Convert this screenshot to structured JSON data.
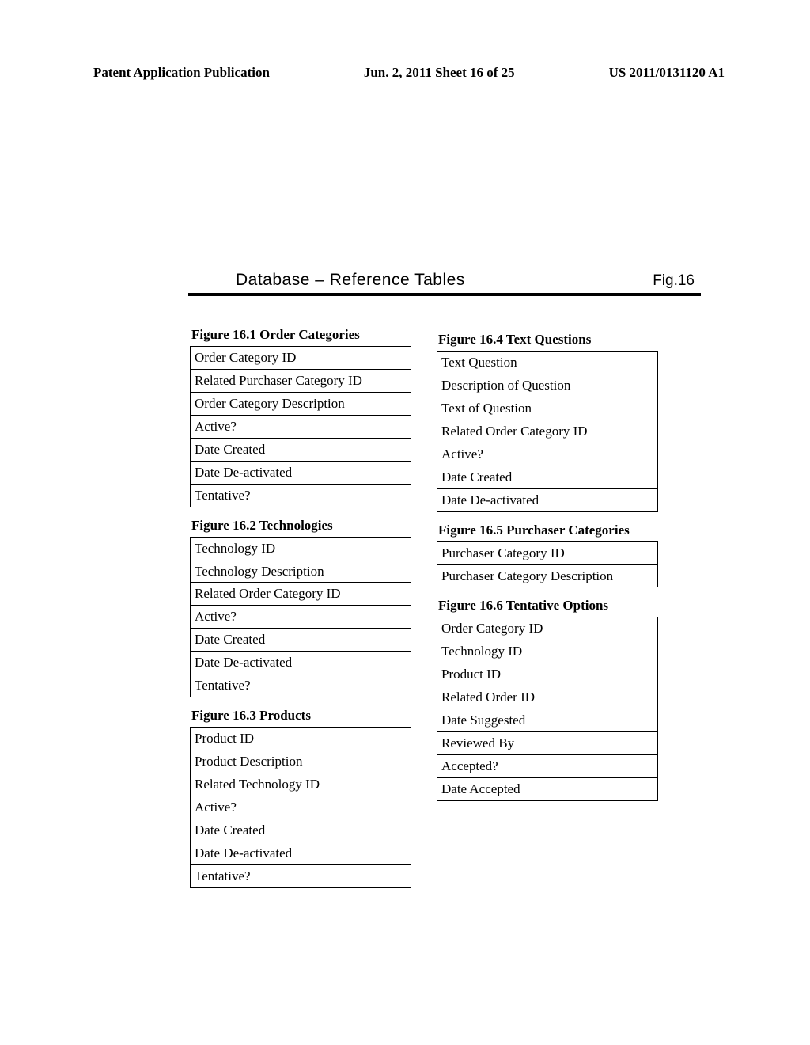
{
  "header": {
    "left": "Patent Application Publication",
    "mid": "Jun. 2, 2011  Sheet 16 of 25",
    "right": "US 2011/0131120 A1"
  },
  "main": {
    "title": "Database – Reference Tables",
    "figLabel": "Fig.16"
  },
  "tables": {
    "t1": {
      "caption": "Figure 16.1 Order Categories",
      "rows": [
        "Order Category ID",
        "Related Purchaser Category ID",
        "Order Category Description",
        "Active?",
        "Date Created",
        "Date De-activated",
        "Tentative?"
      ]
    },
    "t2": {
      "caption": "Figure 16.2 Technologies",
      "rows": [
        "Technology ID",
        "Technology Description",
        "Related Order Category ID",
        "Active?",
        "Date Created",
        "Date De-activated",
        "Tentative?"
      ]
    },
    "t3": {
      "caption": "Figure 16.3 Products",
      "rows": [
        "Product ID",
        "Product Description",
        "Related Technology ID",
        "Active?",
        "Date Created",
        "Date De-activated",
        "Tentative?"
      ]
    },
    "t4": {
      "caption": "Figure 16.4 Text Questions",
      "rows": [
        "Text Question",
        "Description of Question",
        "Text of Question",
        "Related Order Category ID",
        "Active?",
        "Date Created",
        "Date De-activated"
      ]
    },
    "t5": {
      "caption": "Figure 16.5 Purchaser Categories",
      "rows": [
        "Purchaser Category ID",
        "Purchaser Category Description"
      ]
    },
    "t6": {
      "caption": "Figure 16.6 Tentative Options",
      "rows": [
        "Order Category ID",
        "Technology ID",
        "Product ID",
        "Related Order ID",
        "Date Suggested",
        "Reviewed By",
        "Accepted?",
        "Date Accepted"
      ]
    }
  }
}
